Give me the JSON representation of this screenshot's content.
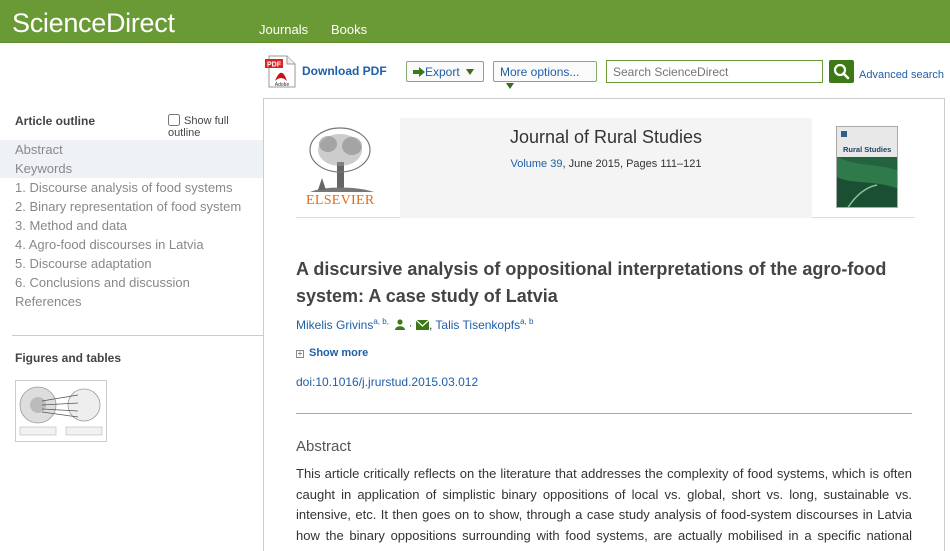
{
  "header": {
    "logo": "ScienceDirect",
    "nav": [
      "Journals",
      "Books"
    ]
  },
  "toolbar": {
    "download_pdf": "Download PDF",
    "export": "Export",
    "more_options": "More options...",
    "search_placeholder": "Search ScienceDirect",
    "advanced_search": "Advanced search"
  },
  "sidebar": {
    "outline_title": "Article outline",
    "show_full_outline": "Show full outline",
    "items": [
      "Abstract",
      "Keywords",
      "1. Discourse analysis of food systems",
      "2. Binary representation of food system",
      "3. Method and data",
      "4. Agro-food discourses in Latvia",
      "5. Discourse adaptation",
      "6. Conclusions and discussion",
      "References"
    ],
    "figures_title": "Figures and tables"
  },
  "journal": {
    "publisher": "ELSEVIER",
    "title": "Journal of Rural Studies",
    "volume": "Volume 39",
    "meta_rest": ", June 2015, Pages 111–121",
    "cover_title": "Rural Studies"
  },
  "article": {
    "title": "A discursive analysis of oppositional interpretations of the agro-food system: A case study of Latvia",
    "authors": [
      {
        "name": "Mikelis Grivins",
        "sup": "a, b,"
      },
      {
        "name": "Talis Tisenkopfs",
        "sup": "a, b"
      }
    ],
    "show_more": "Show more",
    "doi": "doi:10.1016/j.jrurstud.2015.03.012",
    "abstract_heading": "Abstract",
    "abstract_text": "This article critically reflects on the literature that addresses the complexity of food systems, which is often caught in application of simplistic binary oppositions of local vs. global, short vs. long, sustainable vs. intensive, etc. It then goes on to show, through a case study analysis of food-system discourses in Latvia how the binary oppositions surrounding with food systems, are actually mobilised in a specific national context."
  }
}
